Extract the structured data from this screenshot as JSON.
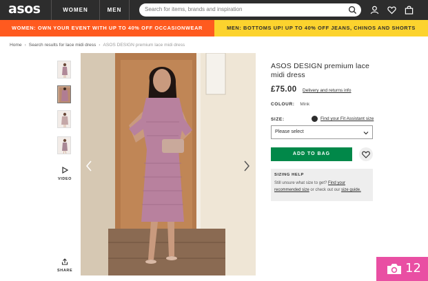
{
  "header": {
    "logo": "asos",
    "nav": [
      "WOMEN",
      "MEN"
    ],
    "search_placeholder": "Search for items, brands and inspiration"
  },
  "promos": {
    "left": "WOMEN: OWN YOUR EVENT WITH UP TO 40% OFF OCCASIONWEAR",
    "right": "MEN: BOTTOMS UP! UP TO 40% OFF JEANS, CHINOS AND SHORTS"
  },
  "breadcrumb": {
    "items": [
      "Home",
      "Search results for lace midi dress",
      "ASOS DESIGN premium lace midi dress"
    ]
  },
  "gallery": {
    "video_label": "VIDEO",
    "share_label": "SHARE"
  },
  "product": {
    "title": "ASOS DESIGN premium lace midi dress",
    "price": "£75.00",
    "delivery_link": "Delivery and returns info",
    "colour_label": "COLOUR:",
    "colour_value": "Mink",
    "size_label": "SIZE:",
    "fit_assistant": "Find your Fit Assistant size",
    "size_select": "Please select",
    "add_to_bag": "ADD TO BAG"
  },
  "sizing_help": {
    "title": "SIZING HELP",
    "text_1": "Still unsure what size to get?",
    "link_1": "Find your recommended size",
    "text_2": "or check out our",
    "link_2": "size guide."
  },
  "photo_badge": {
    "count": "12"
  },
  "colors": {
    "header_bg": "#2d2d2d",
    "promo_left": "#ff5a1f",
    "promo_right": "#fcd32e",
    "add_to_bag": "#018849",
    "badge": "#e94fa3"
  }
}
